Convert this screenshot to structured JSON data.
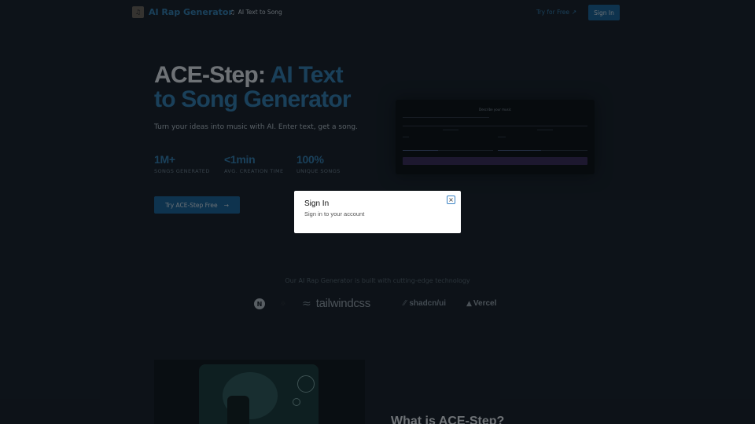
{
  "header": {
    "brand": "AI Rap Generator",
    "brand_icon": "music-logo-icon",
    "nav_link": "AI Text to Song",
    "try_link": "Try for Free",
    "sign_in": "Sign In"
  },
  "hero": {
    "title_plain": "ACE-Step: ",
    "title_accent_1": "AI Text",
    "title_accent_2": "to Song Generator",
    "subtitle": "Turn your ideas into music with AI. Enter text, get a song.",
    "stats": [
      {
        "value": "1M+",
        "label": "SONGS GENERATED"
      },
      {
        "value": "<1min",
        "label": "AVG. CREATION TIME"
      },
      {
        "value": "100%",
        "label": "UNIQUE SONGS"
      }
    ],
    "cta": "Try ACE-Step Free",
    "cta_arrow": "→"
  },
  "preview": {
    "title": "Describe your music"
  },
  "modal": {
    "title": "Sign In",
    "description": "Sign in to your account",
    "close_symbol": "×"
  },
  "tech": {
    "caption": "Our AI Rap Generator is built with cutting-edge technology",
    "logos": [
      "N",
      "tailwindcss",
      "shadcn/ui",
      "Vercel"
    ]
  },
  "section": {
    "title": "What is ACE-Step?"
  },
  "colors": {
    "accent": "#2f7fb3",
    "button": "#16639a",
    "background": "#121a22"
  }
}
